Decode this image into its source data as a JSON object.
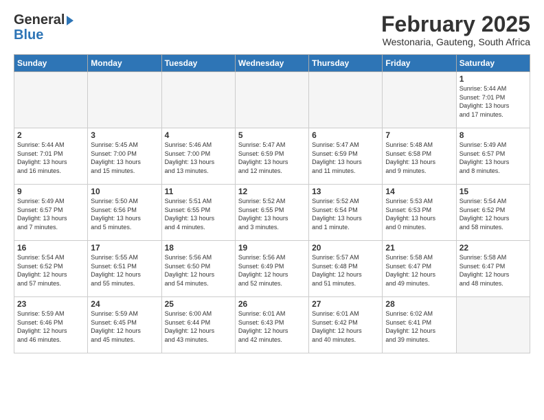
{
  "header": {
    "logo_line1": "General",
    "logo_line2": "Blue",
    "title": "February 2025",
    "subtitle": "Westonaria, Gauteng, South Africa"
  },
  "weekdays": [
    "Sunday",
    "Monday",
    "Tuesday",
    "Wednesday",
    "Thursday",
    "Friday",
    "Saturday"
  ],
  "weeks": [
    [
      {
        "day": "",
        "info": ""
      },
      {
        "day": "",
        "info": ""
      },
      {
        "day": "",
        "info": ""
      },
      {
        "day": "",
        "info": ""
      },
      {
        "day": "",
        "info": ""
      },
      {
        "day": "",
        "info": ""
      },
      {
        "day": "1",
        "info": "Sunrise: 5:44 AM\nSunset: 7:01 PM\nDaylight: 13 hours\nand 17 minutes."
      }
    ],
    [
      {
        "day": "2",
        "info": "Sunrise: 5:44 AM\nSunset: 7:01 PM\nDaylight: 13 hours\nand 16 minutes."
      },
      {
        "day": "3",
        "info": "Sunrise: 5:45 AM\nSunset: 7:00 PM\nDaylight: 13 hours\nand 15 minutes."
      },
      {
        "day": "4",
        "info": "Sunrise: 5:46 AM\nSunset: 7:00 PM\nDaylight: 13 hours\nand 13 minutes."
      },
      {
        "day": "5",
        "info": "Sunrise: 5:47 AM\nSunset: 6:59 PM\nDaylight: 13 hours\nand 12 minutes."
      },
      {
        "day": "6",
        "info": "Sunrise: 5:47 AM\nSunset: 6:59 PM\nDaylight: 13 hours\nand 11 minutes."
      },
      {
        "day": "7",
        "info": "Sunrise: 5:48 AM\nSunset: 6:58 PM\nDaylight: 13 hours\nand 9 minutes."
      },
      {
        "day": "8",
        "info": "Sunrise: 5:49 AM\nSunset: 6:57 PM\nDaylight: 13 hours\nand 8 minutes."
      }
    ],
    [
      {
        "day": "9",
        "info": "Sunrise: 5:49 AM\nSunset: 6:57 PM\nDaylight: 13 hours\nand 7 minutes."
      },
      {
        "day": "10",
        "info": "Sunrise: 5:50 AM\nSunset: 6:56 PM\nDaylight: 13 hours\nand 5 minutes."
      },
      {
        "day": "11",
        "info": "Sunrise: 5:51 AM\nSunset: 6:55 PM\nDaylight: 13 hours\nand 4 minutes."
      },
      {
        "day": "12",
        "info": "Sunrise: 5:52 AM\nSunset: 6:55 PM\nDaylight: 13 hours\nand 3 minutes."
      },
      {
        "day": "13",
        "info": "Sunrise: 5:52 AM\nSunset: 6:54 PM\nDaylight: 13 hours\nand 1 minute."
      },
      {
        "day": "14",
        "info": "Sunrise: 5:53 AM\nSunset: 6:53 PM\nDaylight: 13 hours\nand 0 minutes."
      },
      {
        "day": "15",
        "info": "Sunrise: 5:54 AM\nSunset: 6:52 PM\nDaylight: 12 hours\nand 58 minutes."
      }
    ],
    [
      {
        "day": "16",
        "info": "Sunrise: 5:54 AM\nSunset: 6:52 PM\nDaylight: 12 hours\nand 57 minutes."
      },
      {
        "day": "17",
        "info": "Sunrise: 5:55 AM\nSunset: 6:51 PM\nDaylight: 12 hours\nand 55 minutes."
      },
      {
        "day": "18",
        "info": "Sunrise: 5:56 AM\nSunset: 6:50 PM\nDaylight: 12 hours\nand 54 minutes."
      },
      {
        "day": "19",
        "info": "Sunrise: 5:56 AM\nSunset: 6:49 PM\nDaylight: 12 hours\nand 52 minutes."
      },
      {
        "day": "20",
        "info": "Sunrise: 5:57 AM\nSunset: 6:48 PM\nDaylight: 12 hours\nand 51 minutes."
      },
      {
        "day": "21",
        "info": "Sunrise: 5:58 AM\nSunset: 6:47 PM\nDaylight: 12 hours\nand 49 minutes."
      },
      {
        "day": "22",
        "info": "Sunrise: 5:58 AM\nSunset: 6:47 PM\nDaylight: 12 hours\nand 48 minutes."
      }
    ],
    [
      {
        "day": "23",
        "info": "Sunrise: 5:59 AM\nSunset: 6:46 PM\nDaylight: 12 hours\nand 46 minutes."
      },
      {
        "day": "24",
        "info": "Sunrise: 5:59 AM\nSunset: 6:45 PM\nDaylight: 12 hours\nand 45 minutes."
      },
      {
        "day": "25",
        "info": "Sunrise: 6:00 AM\nSunset: 6:44 PM\nDaylight: 12 hours\nand 43 minutes."
      },
      {
        "day": "26",
        "info": "Sunrise: 6:01 AM\nSunset: 6:43 PM\nDaylight: 12 hours\nand 42 minutes."
      },
      {
        "day": "27",
        "info": "Sunrise: 6:01 AM\nSunset: 6:42 PM\nDaylight: 12 hours\nand 40 minutes."
      },
      {
        "day": "28",
        "info": "Sunrise: 6:02 AM\nSunset: 6:41 PM\nDaylight: 12 hours\nand 39 minutes."
      },
      {
        "day": "",
        "info": ""
      }
    ]
  ]
}
